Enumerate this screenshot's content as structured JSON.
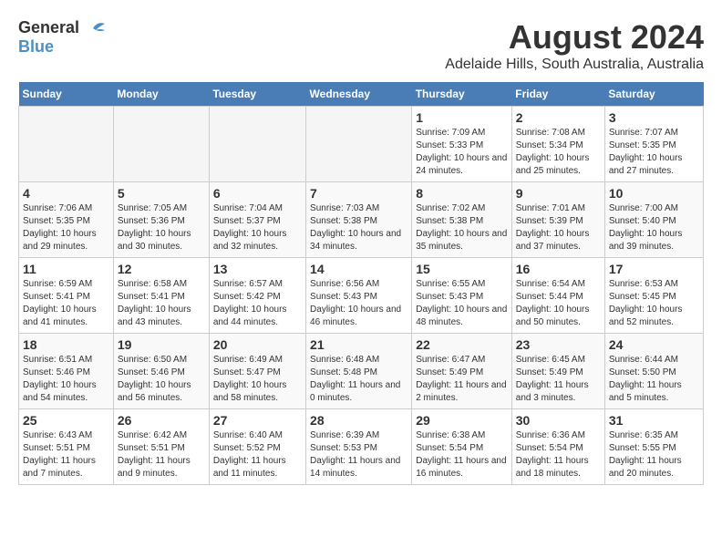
{
  "header": {
    "logo_general": "General",
    "logo_blue": "Blue",
    "title": "August 2024",
    "subtitle": "Adelaide Hills, South Australia, Australia"
  },
  "calendar": {
    "days_of_week": [
      "Sunday",
      "Monday",
      "Tuesday",
      "Wednesday",
      "Thursday",
      "Friday",
      "Saturday"
    ],
    "weeks": [
      [
        {
          "day": "",
          "empty": true
        },
        {
          "day": "",
          "empty": true
        },
        {
          "day": "",
          "empty": true
        },
        {
          "day": "",
          "empty": true
        },
        {
          "day": "1",
          "sunrise": "Sunrise: 7:09 AM",
          "sunset": "Sunset: 5:33 PM",
          "daylight": "Daylight: 10 hours and 24 minutes."
        },
        {
          "day": "2",
          "sunrise": "Sunrise: 7:08 AM",
          "sunset": "Sunset: 5:34 PM",
          "daylight": "Daylight: 10 hours and 25 minutes."
        },
        {
          "day": "3",
          "sunrise": "Sunrise: 7:07 AM",
          "sunset": "Sunset: 5:35 PM",
          "daylight": "Daylight: 10 hours and 27 minutes."
        }
      ],
      [
        {
          "day": "4",
          "sunrise": "Sunrise: 7:06 AM",
          "sunset": "Sunset: 5:35 PM",
          "daylight": "Daylight: 10 hours and 29 minutes."
        },
        {
          "day": "5",
          "sunrise": "Sunrise: 7:05 AM",
          "sunset": "Sunset: 5:36 PM",
          "daylight": "Daylight: 10 hours and 30 minutes."
        },
        {
          "day": "6",
          "sunrise": "Sunrise: 7:04 AM",
          "sunset": "Sunset: 5:37 PM",
          "daylight": "Daylight: 10 hours and 32 minutes."
        },
        {
          "day": "7",
          "sunrise": "Sunrise: 7:03 AM",
          "sunset": "Sunset: 5:38 PM",
          "daylight": "Daylight: 10 hours and 34 minutes."
        },
        {
          "day": "8",
          "sunrise": "Sunrise: 7:02 AM",
          "sunset": "Sunset: 5:38 PM",
          "daylight": "Daylight: 10 hours and 35 minutes."
        },
        {
          "day": "9",
          "sunrise": "Sunrise: 7:01 AM",
          "sunset": "Sunset: 5:39 PM",
          "daylight": "Daylight: 10 hours and 37 minutes."
        },
        {
          "day": "10",
          "sunrise": "Sunrise: 7:00 AM",
          "sunset": "Sunset: 5:40 PM",
          "daylight": "Daylight: 10 hours and 39 minutes."
        }
      ],
      [
        {
          "day": "11",
          "sunrise": "Sunrise: 6:59 AM",
          "sunset": "Sunset: 5:41 PM",
          "daylight": "Daylight: 10 hours and 41 minutes."
        },
        {
          "day": "12",
          "sunrise": "Sunrise: 6:58 AM",
          "sunset": "Sunset: 5:41 PM",
          "daylight": "Daylight: 10 hours and 43 minutes."
        },
        {
          "day": "13",
          "sunrise": "Sunrise: 6:57 AM",
          "sunset": "Sunset: 5:42 PM",
          "daylight": "Daylight: 10 hours and 44 minutes."
        },
        {
          "day": "14",
          "sunrise": "Sunrise: 6:56 AM",
          "sunset": "Sunset: 5:43 PM",
          "daylight": "Daylight: 10 hours and 46 minutes."
        },
        {
          "day": "15",
          "sunrise": "Sunrise: 6:55 AM",
          "sunset": "Sunset: 5:43 PM",
          "daylight": "Daylight: 10 hours and 48 minutes."
        },
        {
          "day": "16",
          "sunrise": "Sunrise: 6:54 AM",
          "sunset": "Sunset: 5:44 PM",
          "daylight": "Daylight: 10 hours and 50 minutes."
        },
        {
          "day": "17",
          "sunrise": "Sunrise: 6:53 AM",
          "sunset": "Sunset: 5:45 PM",
          "daylight": "Daylight: 10 hours and 52 minutes."
        }
      ],
      [
        {
          "day": "18",
          "sunrise": "Sunrise: 6:51 AM",
          "sunset": "Sunset: 5:46 PM",
          "daylight": "Daylight: 10 hours and 54 minutes."
        },
        {
          "day": "19",
          "sunrise": "Sunrise: 6:50 AM",
          "sunset": "Sunset: 5:46 PM",
          "daylight": "Daylight: 10 hours and 56 minutes."
        },
        {
          "day": "20",
          "sunrise": "Sunrise: 6:49 AM",
          "sunset": "Sunset: 5:47 PM",
          "daylight": "Daylight: 10 hours and 58 minutes."
        },
        {
          "day": "21",
          "sunrise": "Sunrise: 6:48 AM",
          "sunset": "Sunset: 5:48 PM",
          "daylight": "Daylight: 11 hours and 0 minutes."
        },
        {
          "day": "22",
          "sunrise": "Sunrise: 6:47 AM",
          "sunset": "Sunset: 5:49 PM",
          "daylight": "Daylight: 11 hours and 2 minutes."
        },
        {
          "day": "23",
          "sunrise": "Sunrise: 6:45 AM",
          "sunset": "Sunset: 5:49 PM",
          "daylight": "Daylight: 11 hours and 3 minutes."
        },
        {
          "day": "24",
          "sunrise": "Sunrise: 6:44 AM",
          "sunset": "Sunset: 5:50 PM",
          "daylight": "Daylight: 11 hours and 5 minutes."
        }
      ],
      [
        {
          "day": "25",
          "sunrise": "Sunrise: 6:43 AM",
          "sunset": "Sunset: 5:51 PM",
          "daylight": "Daylight: 11 hours and 7 minutes."
        },
        {
          "day": "26",
          "sunrise": "Sunrise: 6:42 AM",
          "sunset": "Sunset: 5:51 PM",
          "daylight": "Daylight: 11 hours and 9 minutes."
        },
        {
          "day": "27",
          "sunrise": "Sunrise: 6:40 AM",
          "sunset": "Sunset: 5:52 PM",
          "daylight": "Daylight: 11 hours and 11 minutes."
        },
        {
          "day": "28",
          "sunrise": "Sunrise: 6:39 AM",
          "sunset": "Sunset: 5:53 PM",
          "daylight": "Daylight: 11 hours and 14 minutes."
        },
        {
          "day": "29",
          "sunrise": "Sunrise: 6:38 AM",
          "sunset": "Sunset: 5:54 PM",
          "daylight": "Daylight: 11 hours and 16 minutes."
        },
        {
          "day": "30",
          "sunrise": "Sunrise: 6:36 AM",
          "sunset": "Sunset: 5:54 PM",
          "daylight": "Daylight: 11 hours and 18 minutes."
        },
        {
          "day": "31",
          "sunrise": "Sunrise: 6:35 AM",
          "sunset": "Sunset: 5:55 PM",
          "daylight": "Daylight: 11 hours and 20 minutes."
        }
      ]
    ]
  }
}
